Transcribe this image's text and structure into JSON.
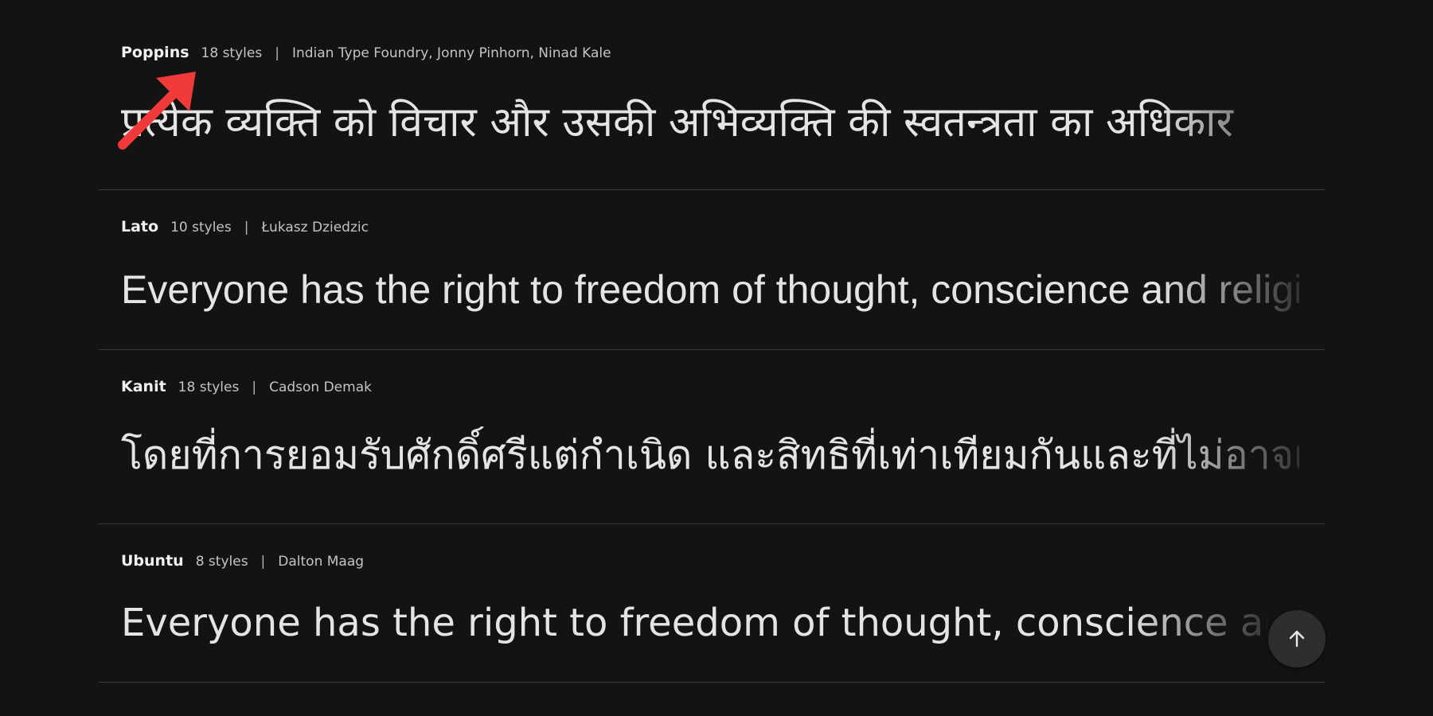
{
  "fonts": [
    {
      "family": "Poppins",
      "styles": "18 styles",
      "separator": "|",
      "designers": "Indian Type Foundry, Jonny Pinhorn, Ninad Kale",
      "sample": "प्रत्येक व्यक्ति को विचार और उसकी अभिव्यक्ति की स्वतन्त्रता का अधिकार"
    },
    {
      "family": "Lato",
      "styles": "10 styles",
      "separator": "|",
      "designers": "Łukasz Dziedzic",
      "sample": "Everyone has the right to freedom of thought, conscience and religion"
    },
    {
      "family": "Kanit",
      "styles": "18 styles",
      "separator": "|",
      "designers": "Cadson Demak",
      "sample": "โดยที่การยอมรับศักดิ์ศรีแต่กำเนิด และสิทธิที่เท่าเทียมกันและที่ไม่อาจเพิกถอน"
    },
    {
      "family": "Ubuntu",
      "styles": "8 styles",
      "separator": "|",
      "designers": "Dalton Maag",
      "sample": "Everyone has the right to freedom of thought, conscience and religion"
    }
  ],
  "annotation": {
    "arrow_color": "#f03a3a",
    "arrow_icon": "annotation-arrow-icon"
  },
  "scroll_top": {
    "icon": "arrow-up-icon"
  }
}
